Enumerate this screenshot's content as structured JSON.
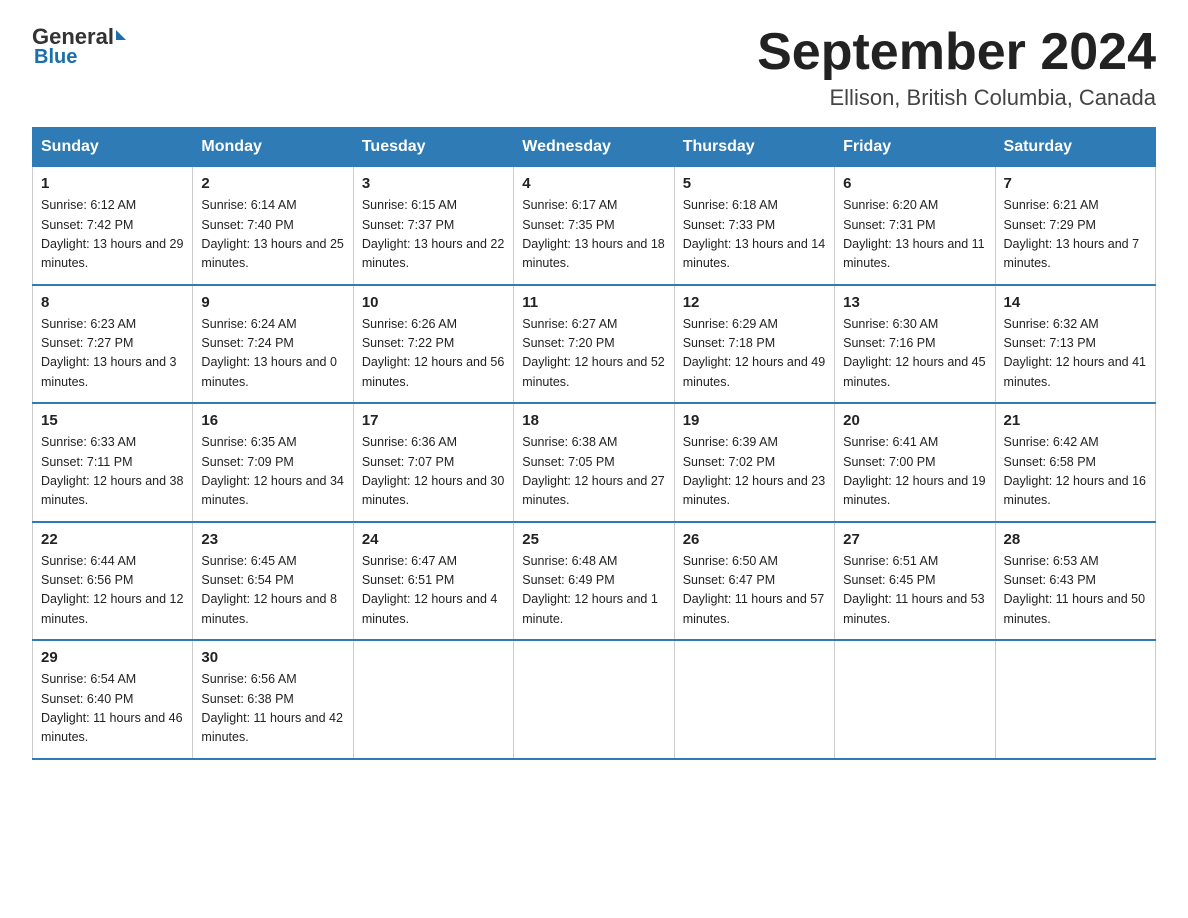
{
  "logo": {
    "general": "General",
    "blue": "Blue"
  },
  "title": "September 2024",
  "location": "Ellison, British Columbia, Canada",
  "weekdays": [
    "Sunday",
    "Monday",
    "Tuesday",
    "Wednesday",
    "Thursday",
    "Friday",
    "Saturday"
  ],
  "weeks": [
    [
      {
        "day": "1",
        "sunrise": "6:12 AM",
        "sunset": "7:42 PM",
        "daylight": "13 hours and 29 minutes."
      },
      {
        "day": "2",
        "sunrise": "6:14 AM",
        "sunset": "7:40 PM",
        "daylight": "13 hours and 25 minutes."
      },
      {
        "day": "3",
        "sunrise": "6:15 AM",
        "sunset": "7:37 PM",
        "daylight": "13 hours and 22 minutes."
      },
      {
        "day": "4",
        "sunrise": "6:17 AM",
        "sunset": "7:35 PM",
        "daylight": "13 hours and 18 minutes."
      },
      {
        "day": "5",
        "sunrise": "6:18 AM",
        "sunset": "7:33 PM",
        "daylight": "13 hours and 14 minutes."
      },
      {
        "day": "6",
        "sunrise": "6:20 AM",
        "sunset": "7:31 PM",
        "daylight": "13 hours and 11 minutes."
      },
      {
        "day": "7",
        "sunrise": "6:21 AM",
        "sunset": "7:29 PM",
        "daylight": "13 hours and 7 minutes."
      }
    ],
    [
      {
        "day": "8",
        "sunrise": "6:23 AM",
        "sunset": "7:27 PM",
        "daylight": "13 hours and 3 minutes."
      },
      {
        "day": "9",
        "sunrise": "6:24 AM",
        "sunset": "7:24 PM",
        "daylight": "13 hours and 0 minutes."
      },
      {
        "day": "10",
        "sunrise": "6:26 AM",
        "sunset": "7:22 PM",
        "daylight": "12 hours and 56 minutes."
      },
      {
        "day": "11",
        "sunrise": "6:27 AM",
        "sunset": "7:20 PM",
        "daylight": "12 hours and 52 minutes."
      },
      {
        "day": "12",
        "sunrise": "6:29 AM",
        "sunset": "7:18 PM",
        "daylight": "12 hours and 49 minutes."
      },
      {
        "day": "13",
        "sunrise": "6:30 AM",
        "sunset": "7:16 PM",
        "daylight": "12 hours and 45 minutes."
      },
      {
        "day": "14",
        "sunrise": "6:32 AM",
        "sunset": "7:13 PM",
        "daylight": "12 hours and 41 minutes."
      }
    ],
    [
      {
        "day": "15",
        "sunrise": "6:33 AM",
        "sunset": "7:11 PM",
        "daylight": "12 hours and 38 minutes."
      },
      {
        "day": "16",
        "sunrise": "6:35 AM",
        "sunset": "7:09 PM",
        "daylight": "12 hours and 34 minutes."
      },
      {
        "day": "17",
        "sunrise": "6:36 AM",
        "sunset": "7:07 PM",
        "daylight": "12 hours and 30 minutes."
      },
      {
        "day": "18",
        "sunrise": "6:38 AM",
        "sunset": "7:05 PM",
        "daylight": "12 hours and 27 minutes."
      },
      {
        "day": "19",
        "sunrise": "6:39 AM",
        "sunset": "7:02 PM",
        "daylight": "12 hours and 23 minutes."
      },
      {
        "day": "20",
        "sunrise": "6:41 AM",
        "sunset": "7:00 PM",
        "daylight": "12 hours and 19 minutes."
      },
      {
        "day": "21",
        "sunrise": "6:42 AM",
        "sunset": "6:58 PM",
        "daylight": "12 hours and 16 minutes."
      }
    ],
    [
      {
        "day": "22",
        "sunrise": "6:44 AM",
        "sunset": "6:56 PM",
        "daylight": "12 hours and 12 minutes."
      },
      {
        "day": "23",
        "sunrise": "6:45 AM",
        "sunset": "6:54 PM",
        "daylight": "12 hours and 8 minutes."
      },
      {
        "day": "24",
        "sunrise": "6:47 AM",
        "sunset": "6:51 PM",
        "daylight": "12 hours and 4 minutes."
      },
      {
        "day": "25",
        "sunrise": "6:48 AM",
        "sunset": "6:49 PM",
        "daylight": "12 hours and 1 minute."
      },
      {
        "day": "26",
        "sunrise": "6:50 AM",
        "sunset": "6:47 PM",
        "daylight": "11 hours and 57 minutes."
      },
      {
        "day": "27",
        "sunrise": "6:51 AM",
        "sunset": "6:45 PM",
        "daylight": "11 hours and 53 minutes."
      },
      {
        "day": "28",
        "sunrise": "6:53 AM",
        "sunset": "6:43 PM",
        "daylight": "11 hours and 50 minutes."
      }
    ],
    [
      {
        "day": "29",
        "sunrise": "6:54 AM",
        "sunset": "6:40 PM",
        "daylight": "11 hours and 46 minutes."
      },
      {
        "day": "30",
        "sunrise": "6:56 AM",
        "sunset": "6:38 PM",
        "daylight": "11 hours and 42 minutes."
      },
      null,
      null,
      null,
      null,
      null
    ]
  ]
}
